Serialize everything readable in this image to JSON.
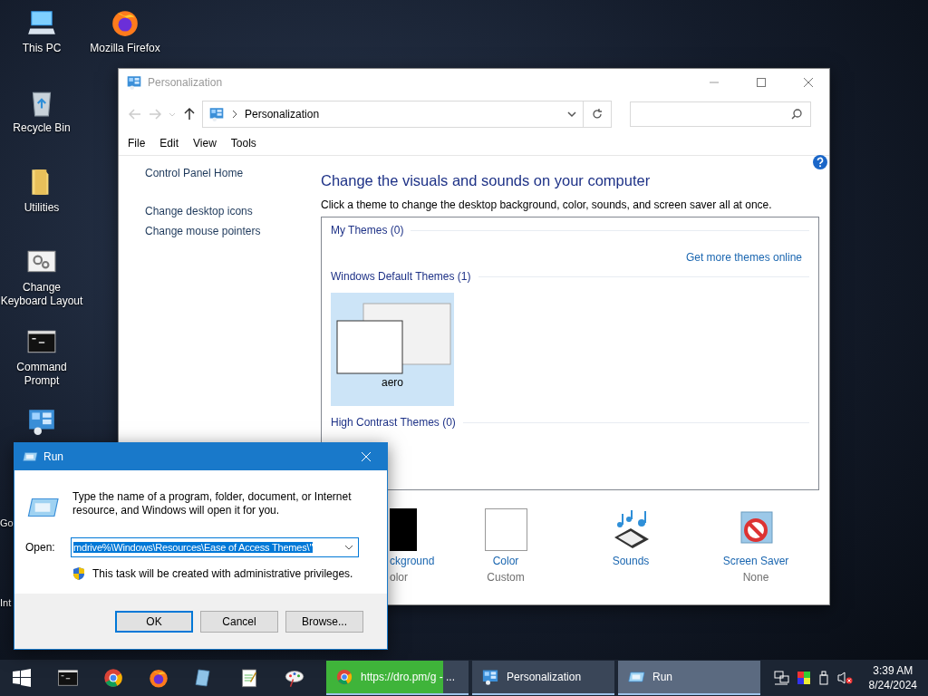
{
  "desktop_icons": [
    {
      "label": "This PC",
      "kind": "pc"
    },
    {
      "label": "Mozilla Firefox",
      "kind": "firefox"
    },
    {
      "label": "Recycle Bin",
      "kind": "bin"
    },
    {
      "label": "Utilities",
      "kind": "folder"
    },
    {
      "label": "Change Keyboard Layout",
      "kind": "gears"
    },
    {
      "label": "Command Prompt",
      "kind": "cmd"
    },
    {
      "kind": "panel"
    },
    {
      "label": "Go",
      "kind": "hidden"
    },
    {
      "label": "Int",
      "kind": "hidden"
    }
  ],
  "personalization": {
    "title": "Personalization",
    "address": "Personalization",
    "menu": [
      "File",
      "Edit",
      "View",
      "Tools"
    ],
    "sidebar": [
      "Control Panel Home",
      "Change desktop icons",
      "Change mouse pointers"
    ],
    "heading": "Change the visuals and sounds on your computer",
    "description": "Click a theme to change the desktop background, color, sounds, and screen saver all at once.",
    "groups": [
      {
        "title": "My Themes (0)",
        "link": "Get more themes online"
      },
      {
        "title": "Windows Default Themes (1)",
        "themes": [
          {
            "name": "aero",
            "selected": true
          }
        ]
      },
      {
        "title": "High Contrast Themes (0)"
      }
    ],
    "settings": [
      {
        "kind": "background",
        "label": "ckground",
        "sub": "olor"
      },
      {
        "kind": "color",
        "label": "Color",
        "sub": "Custom"
      },
      {
        "kind": "sounds",
        "label": "Sounds"
      },
      {
        "kind": "screensaver",
        "label": "Screen Saver",
        "sub": "None"
      }
    ]
  },
  "run": {
    "title": "Run",
    "description": "Type the name of a program, folder, document, or Internet resource, and Windows will open it for you.",
    "open_label": "Open:",
    "value": "mdrive%\\Windows\\Resources\\Ease of Access Themes\\\"",
    "admin_note": "This task will be created with administrative privileges.",
    "buttons": [
      {
        "label": "OK",
        "focused": true
      },
      {
        "label": "Cancel",
        "focused": false
      },
      {
        "label": "Browse...",
        "focused": false
      }
    ]
  },
  "taskbar": {
    "pinned": [
      {
        "kind": "cmd"
      },
      {
        "kind": "chrome"
      },
      {
        "kind": "firefox"
      },
      {
        "kind": "app"
      },
      {
        "kind": "notepad"
      },
      {
        "kind": "paint"
      }
    ],
    "tasks": [
      {
        "kind": "chrome",
        "label": "https://dro.pm/g - ...",
        "selected": false,
        "level": 0.82
      },
      {
        "kind": "panel",
        "label": "Personalization",
        "selected": false
      },
      {
        "kind": "run",
        "label": "Run",
        "selected": true
      }
    ],
    "time": "3:39 AM",
    "date": "8/24/2024"
  }
}
